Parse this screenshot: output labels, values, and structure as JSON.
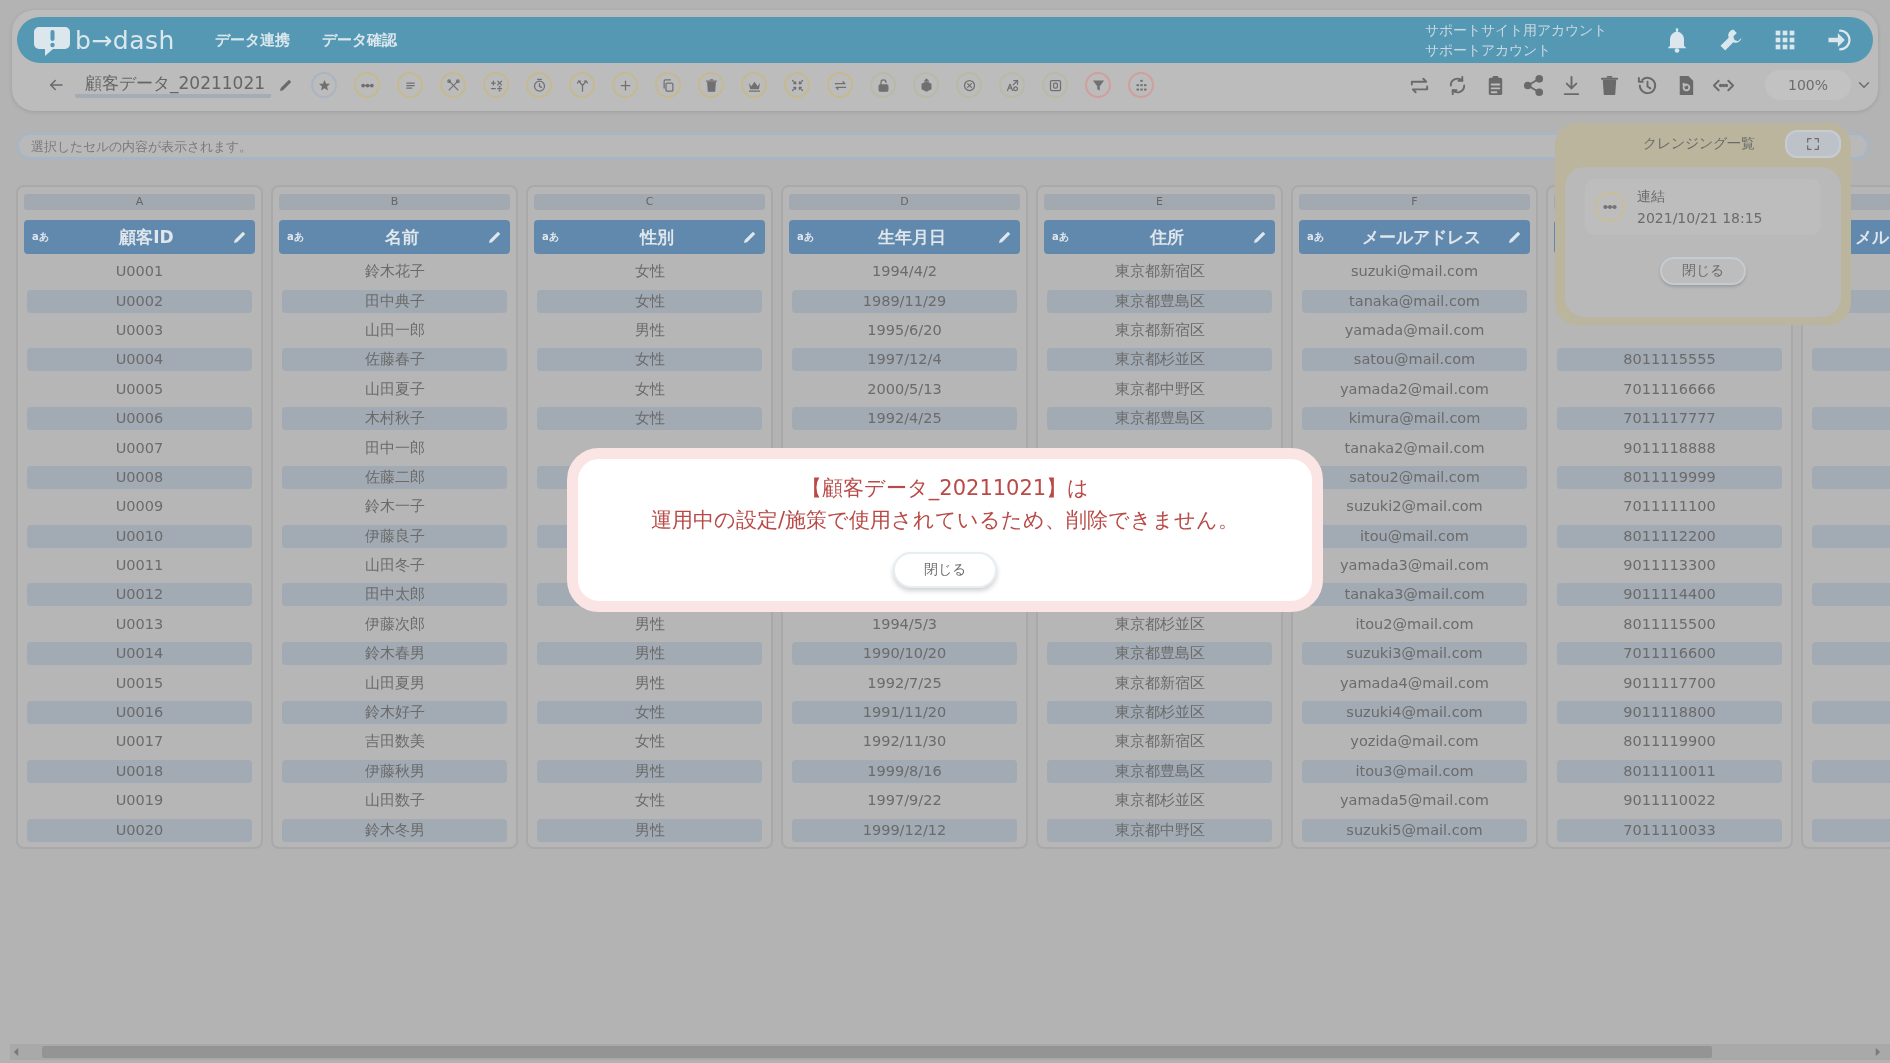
{
  "app": {
    "logo": "b→dash"
  },
  "nav": [
    {
      "label": "データ連携"
    },
    {
      "label": "データ確認"
    }
  ],
  "account": {
    "line_1": "サポートサイト用アカウント",
    "line_2": "サポートアカウント"
  },
  "toolbar": {
    "title": "顧客データ_20211021",
    "zoom": "100%"
  },
  "cell_content": {
    "placeholder": "選択したセルの内容が表示されます。"
  },
  "columns": [
    {
      "letter": "A",
      "type_label": "aあ",
      "name": "顧客ID",
      "cells": [
        "U0001",
        "U0002",
        "U0003",
        "U0004",
        "U0005",
        "U0006",
        "U0007",
        "U0008",
        "U0009",
        "U0010",
        "U0011",
        "U0012",
        "U0013",
        "U0014",
        "U0015",
        "U0016",
        "U0017",
        "U0018",
        "U0019",
        "U0020"
      ]
    },
    {
      "letter": "B",
      "type_label": "aあ",
      "name": "名前",
      "cells": [
        "鈴木花子",
        "田中典子",
        "山田一郎",
        "佐藤春子",
        "山田夏子",
        "木村秋子",
        "田中一郎",
        "佐藤二郎",
        "鈴木一子",
        "伊藤良子",
        "山田冬子",
        "田中太郎",
        "伊藤次郎",
        "鈴木春男",
        "山田夏男",
        "鈴木好子",
        "吉田数美",
        "伊藤秋男",
        "山田数子",
        "鈴木冬男"
      ]
    },
    {
      "letter": "C",
      "type_label": "aあ",
      "name": "性別",
      "cells": [
        "女性",
        "女性",
        "男性",
        "女性",
        "女性",
        "女性",
        null,
        null,
        null,
        null,
        null,
        null,
        "男性",
        "男性",
        "男性",
        "女性",
        "女性",
        "男性",
        "女性",
        "男性"
      ]
    },
    {
      "letter": "D",
      "type_label": "aあ",
      "name": "生年月日",
      "cells": [
        "1994/4/2",
        "1989/11/29",
        "1995/6/20",
        "1997/12/4",
        "2000/5/13",
        "1992/4/25",
        null,
        null,
        null,
        null,
        null,
        null,
        "1994/5/3",
        "1990/10/20",
        "1992/7/25",
        "1991/11/20",
        "1992/11/30",
        "1999/8/16",
        "1997/9/22",
        "1999/12/12"
      ]
    },
    {
      "letter": "E",
      "type_label": "aあ",
      "name": "住所",
      "cells": [
        "東京都新宿区",
        "東京都豊島区",
        "東京都新宿区",
        "東京都杉並区",
        "東京都中野区",
        "東京都豊島区",
        null,
        null,
        null,
        null,
        null,
        null,
        "東京都杉並区",
        "東京都豊島区",
        "東京都新宿区",
        "東京都杉並区",
        "東京都新宿区",
        "東京都豊島区",
        "東京都杉並区",
        "東京都中野区"
      ]
    },
    {
      "letter": "F",
      "type_label": "aあ",
      "name": "メールアドレス",
      "cells": [
        "suzuki@mail.com",
        "tanaka@mail.com",
        "yamada@mail.com",
        "satou@mail.com",
        "yamada2@mail.com",
        "kimura@mail.com",
        "tanaka2@mail.com",
        "satou2@mail.com",
        "suzuki2@mail.com",
        "itou@mail.com",
        "yamada3@mail.com",
        "tanaka3@mail.com",
        "itou2@mail.com",
        "suzuki3@mail.com",
        "yamada4@mail.com",
        "suzuki4@mail.com",
        "yozida@mail.com",
        "itou3@mail.com",
        "yamada5@mail.com",
        "suzuki5@mail.com"
      ]
    },
    {
      "cells": [
        null,
        null,
        null,
        "8011115555",
        "7011116666",
        "7011117777",
        "9011118888",
        "8011119999",
        "7011111100",
        "8011112200",
        "9011113300",
        "9011114400",
        "8011115500",
        "7011116600",
        "9011117700",
        "9011118800",
        "8011119900",
        "8011110011",
        "9011110022",
        "7011110033"
      ]
    },
    {
      "name": "メル",
      "cells": [
        null,
        null,
        null,
        null,
        null,
        null,
        null,
        null,
        null,
        null,
        null,
        null,
        null,
        null,
        null,
        null,
        null,
        null,
        null,
        null
      ]
    }
  ],
  "cleansing_panel": {
    "title": "クレンジング一覧",
    "items": [
      {
        "name": "連結",
        "time": "2021/10/21 18:15"
      }
    ],
    "close_button": "閉じる"
  },
  "dialog": {
    "title": "【顧客データ_20211021】は",
    "message": "運用中の設定/施策で使用されているため、削除できません。",
    "close_button": "閉じる"
  }
}
